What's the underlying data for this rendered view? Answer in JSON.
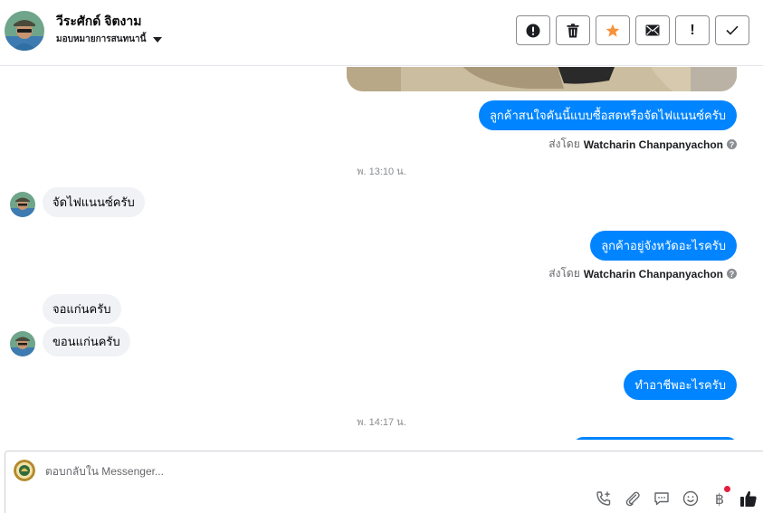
{
  "header": {
    "contact_name": "วีระศักด์ จิตงาม",
    "assign_label": "มอบหมายการสนทนานี้",
    "actions": [
      {
        "name": "mark-spam-button",
        "icon": "alert-circle-icon"
      },
      {
        "name": "delete-button",
        "icon": "trash-icon"
      },
      {
        "name": "star-button",
        "icon": "star-icon",
        "color": "#f7923b"
      },
      {
        "name": "mark-unread-button",
        "icon": "envelope-icon"
      },
      {
        "name": "follow-up-button",
        "icon": "exclamation-icon",
        "text": "!"
      },
      {
        "name": "mark-done-button",
        "icon": "check-icon"
      }
    ]
  },
  "messages": {
    "m1": "ลูกค้าสนใจคันนี้แบบซื้อสดหรือจัดไฟแนนซ์ครับ",
    "sent_by_prefix": "ส่งโดย",
    "sent_by_name": "Watcharin Chanpanyachon",
    "ts1": "พ. 13:10 น.",
    "m2": "จัดไฟแนนซ์ครับ",
    "m3": "ลูกค้าอยู่จังหวัดอะไรครับ",
    "m4": "จอแก่นครับ",
    "m5": "ขอนแก่นครับ",
    "m6": "ทำอาชีพอะไรครับ",
    "ts2": "พ. 14:17 น."
  },
  "composer": {
    "placeholder": "ตอบกลับใน Messenger...",
    "baht_symbol": "฿",
    "tools": [
      "phone-add-icon",
      "paperclip-icon",
      "chat-bubble-icon",
      "smiley-icon",
      "baht-icon",
      "thumbs-up-icon"
    ]
  },
  "colors": {
    "outgoing_bubble": "#0084ff",
    "incoming_bubble": "#f0f2f5",
    "like_icon": "#1c1e21",
    "notification_dot": "#e41e3f"
  }
}
